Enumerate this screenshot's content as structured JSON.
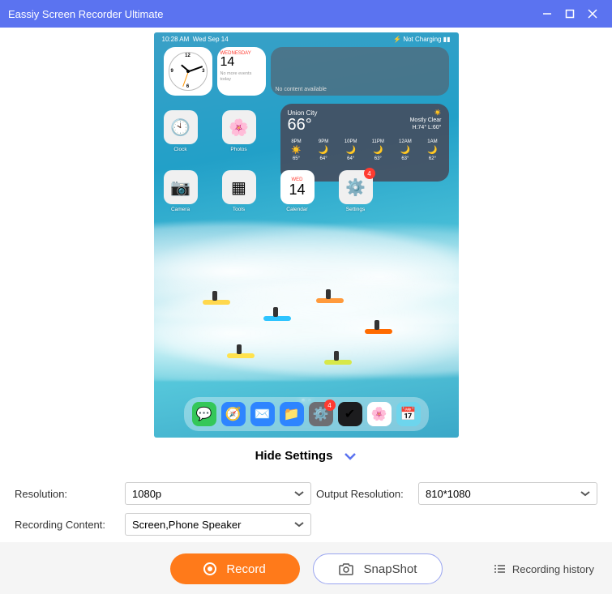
{
  "titlebar": {
    "title": "Eassiy Screen Recorder Ultimate"
  },
  "preview": {
    "status_left_time": "10:28 AM",
    "status_left_date": "Wed Sep 14",
    "status_right": "⚡ Not Charging ▮▮",
    "cal_widget": {
      "dow": "WEDNESDAY",
      "day": "14",
      "nomore": "No more events today"
    },
    "blank_widget": "No content available",
    "weather": {
      "city": "Union City",
      "temp": "66°",
      "cond_line1": "Mostly Clear",
      "cond_line2": "H:74° L:60°",
      "hours": [
        {
          "h": "8PM",
          "i": "☀️",
          "t": "65°"
        },
        {
          "h": "9PM",
          "i": "🌙",
          "t": "64°"
        },
        {
          "h": "10PM",
          "i": "🌙",
          "t": "64°"
        },
        {
          "h": "11PM",
          "i": "🌙",
          "t": "63°"
        },
        {
          "h": "12AM",
          "i": "🌙",
          "t": "63°"
        },
        {
          "h": "1AM",
          "i": "🌙",
          "t": "62°"
        }
      ]
    },
    "apps_r1": [
      {
        "name": "Clock",
        "emoji": "🕙"
      },
      {
        "name": "Photos",
        "emoji": "🌸"
      }
    ],
    "apps_r2": [
      {
        "name": "Camera",
        "emoji": "📷",
        "badge": ""
      },
      {
        "name": "Tools",
        "emoji": "▦",
        "badge": ""
      },
      {
        "name": "Calendar",
        "cal": true,
        "dow": "WED",
        "day": "14",
        "badge": ""
      },
      {
        "name": "Settings",
        "emoji": "⚙️",
        "badge": "4"
      }
    ],
    "dock": [
      {
        "name": "messages",
        "bg": "#34c759",
        "emoji": "💬"
      },
      {
        "name": "safari",
        "bg": "#2e85ff",
        "emoji": "🧭"
      },
      {
        "name": "mail",
        "bg": "#2e85ff",
        "emoji": "✉️"
      },
      {
        "name": "files",
        "bg": "#2e85ff",
        "emoji": "📁"
      },
      {
        "name": "settings",
        "bg": "#6e6e73",
        "emoji": "⚙️",
        "badge": "4"
      },
      {
        "name": "reminders",
        "bg": "#1c1c1e",
        "emoji": "✔"
      },
      {
        "name": "photos",
        "bg": "#fff",
        "emoji": "🌸"
      },
      {
        "name": "calendar",
        "bg": "#6dd5ed",
        "emoji": "📅"
      }
    ]
  },
  "hide_settings_label": "Hide Settings",
  "settings": {
    "resolution_label": "Resolution:",
    "resolution_value": "1080p",
    "output_res_label": "Output Resolution:",
    "output_res_value": "810*1080",
    "content_label": "Recording Content:",
    "content_value": "Screen,Phone Speaker"
  },
  "bottom": {
    "record_label": "Record",
    "snapshot_label": "SnapShot",
    "history_label": "Recording history"
  }
}
